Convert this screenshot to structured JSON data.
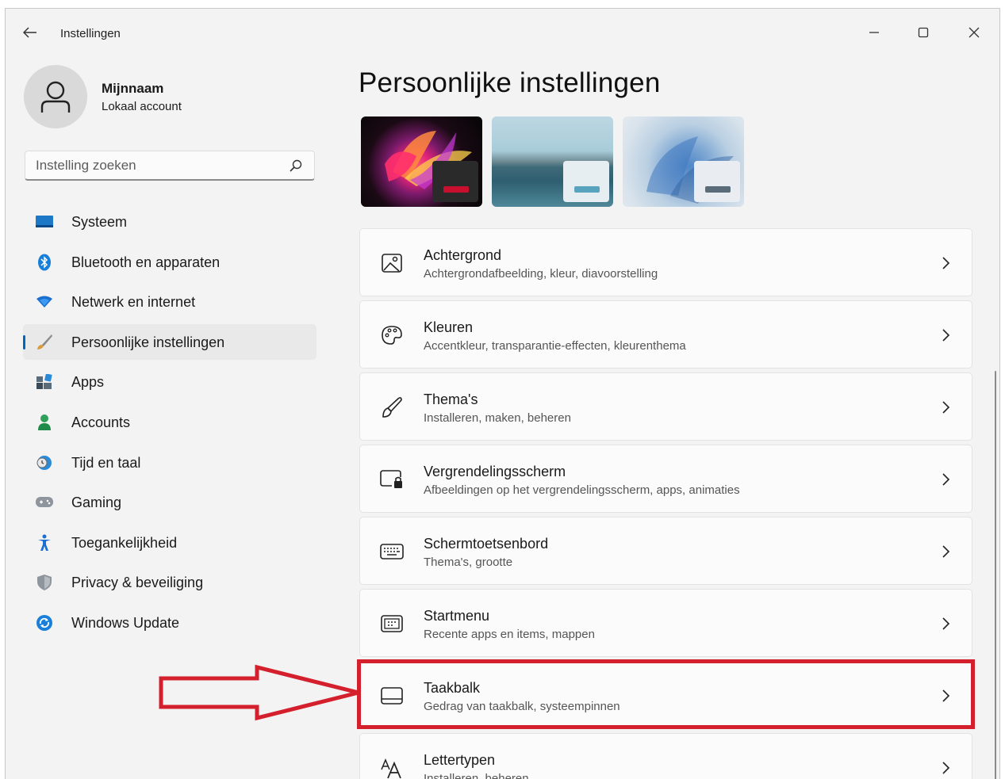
{
  "window": {
    "title": "Instellingen"
  },
  "user": {
    "name": "Mijnnaam",
    "account_type": "Lokaal account"
  },
  "search": {
    "placeholder": "Instelling zoeken",
    "value": ""
  },
  "nav": {
    "items": [
      {
        "label": "Systeem",
        "icon": "monitor-icon"
      },
      {
        "label": "Bluetooth en apparaten",
        "icon": "bluetooth-icon"
      },
      {
        "label": "Netwerk en internet",
        "icon": "wifi-icon"
      },
      {
        "label": "Persoonlijke instellingen",
        "icon": "brush-icon",
        "active": true
      },
      {
        "label": "Apps",
        "icon": "apps-icon"
      },
      {
        "label": "Accounts",
        "icon": "person-icon"
      },
      {
        "label": "Tijd en taal",
        "icon": "globe-clock-icon"
      },
      {
        "label": "Gaming",
        "icon": "gamepad-icon"
      },
      {
        "label": "Toegankelijkheid",
        "icon": "accessibility-icon"
      },
      {
        "label": "Privacy & beveiliging",
        "icon": "shield-icon"
      },
      {
        "label": "Windows Update",
        "icon": "update-icon"
      }
    ]
  },
  "main": {
    "title": "Persoonlijke instellingen",
    "themes": [
      {
        "name": "bloom-dark-theme",
        "accent": "#c8102e"
      },
      {
        "name": "lake-theme",
        "accent": "#5aa3bf"
      },
      {
        "name": "bloom-light-theme",
        "accent": "#5a6b7a"
      }
    ],
    "cards": [
      {
        "title": "Achtergrond",
        "subtitle": "Achtergrondafbeelding, kleur, diavoorstelling",
        "icon": "picture-icon"
      },
      {
        "title": "Kleuren",
        "subtitle": "Accentkleur, transparantie-effecten, kleurenthema",
        "icon": "palette-icon"
      },
      {
        "title": "Thema's",
        "subtitle": "Installeren, maken, beheren",
        "icon": "brush-icon"
      },
      {
        "title": "Vergrendelingsscherm",
        "subtitle": "Afbeeldingen op het vergrendelingsscherm, apps, animaties",
        "icon": "lock-screen-icon"
      },
      {
        "title": "Schermtoetsenbord",
        "subtitle": "Thema's, grootte",
        "icon": "keyboard-icon"
      },
      {
        "title": "Startmenu",
        "subtitle": "Recente apps en items, mappen",
        "icon": "start-menu-icon"
      },
      {
        "title": "Taakbalk",
        "subtitle": "Gedrag van taakbalk, systeempinnen",
        "icon": "taskbar-icon",
        "highlighted": true
      },
      {
        "title": "Lettertypen",
        "subtitle": "Installeren, beheren",
        "icon": "fonts-icon"
      }
    ]
  },
  "colors": {
    "accent": "#0067c0",
    "highlight": "#d41f2c",
    "background": "#f3f3f3",
    "card": "#fbfbfb"
  }
}
